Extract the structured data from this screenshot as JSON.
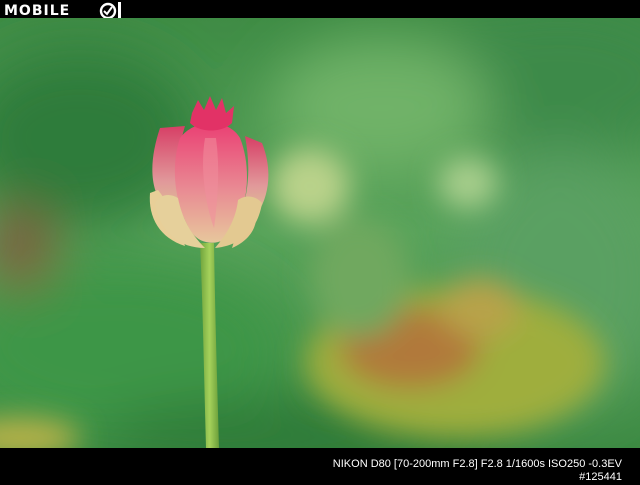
{
  "watermark": {
    "logo_text": "MOBILE",
    "logo_number": "01"
  },
  "caption": {
    "exif": "NIKON D80 [70-200mm F2.8] F2.8 1/1600s ISO250 -0.3EV",
    "photo_id": "#125441"
  },
  "colors": {
    "background_green": "#4f9a52",
    "bud_pink": "#e0637f",
    "stem_green": "#8cbf4a"
  }
}
